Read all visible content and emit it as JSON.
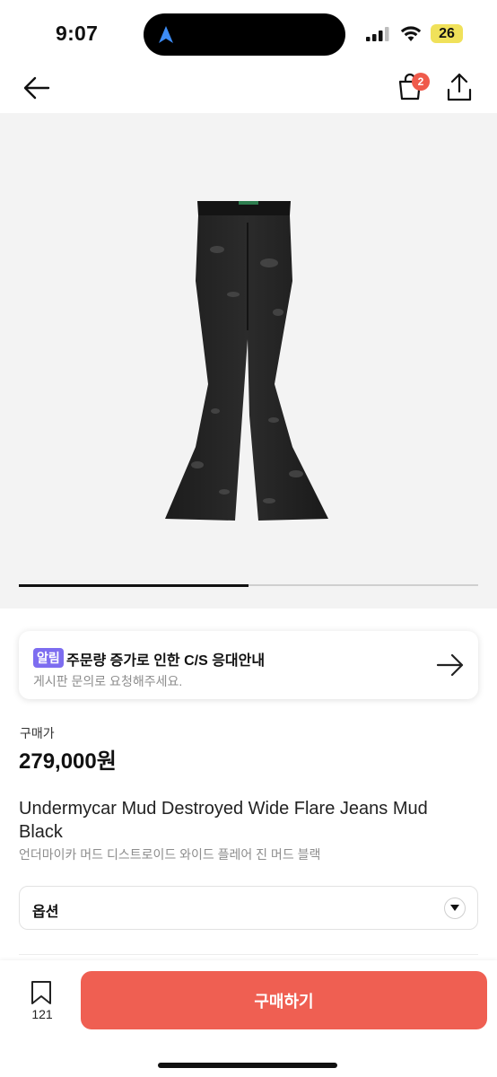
{
  "status_bar": {
    "time": "9:07",
    "battery": "26",
    "icons": [
      "location-arrow-icon",
      "signal-icon",
      "wifi-icon",
      "battery-icon"
    ]
  },
  "nav": {
    "back_icon": "arrow-left-icon",
    "cart_icon": "shopping-bag-icon",
    "cart_count": "2",
    "share_icon": "share-icon"
  },
  "gallery": {
    "image_desc_icon": "jeans-image",
    "progress": 0.5
  },
  "notice": {
    "badge": "알림",
    "title": "주문량 증가로 인한 C/S 응대안내",
    "subtitle": "게시판 문의로 요청해주세요.",
    "arrow_icon": "arrow-right-icon"
  },
  "price": {
    "label": "구매가",
    "value": "279,000원"
  },
  "product": {
    "title_en": "Undermycar Mud Destroyed Wide Flare Jeans Mud Black",
    "title_ko": "언더마이카 머드 디스트로이드 와이드 플레어 진 머드 블랙"
  },
  "option": {
    "label": "옵션",
    "chevron_icon": "chevron-down-icon"
  },
  "bottom": {
    "bookmark_icon": "bookmark-icon",
    "bookmark_count": "121",
    "buy_label": "구매하기"
  },
  "colors": {
    "accent": "#ef5f52",
    "badge": "#7d6df0",
    "battery": "#f0e15a"
  }
}
